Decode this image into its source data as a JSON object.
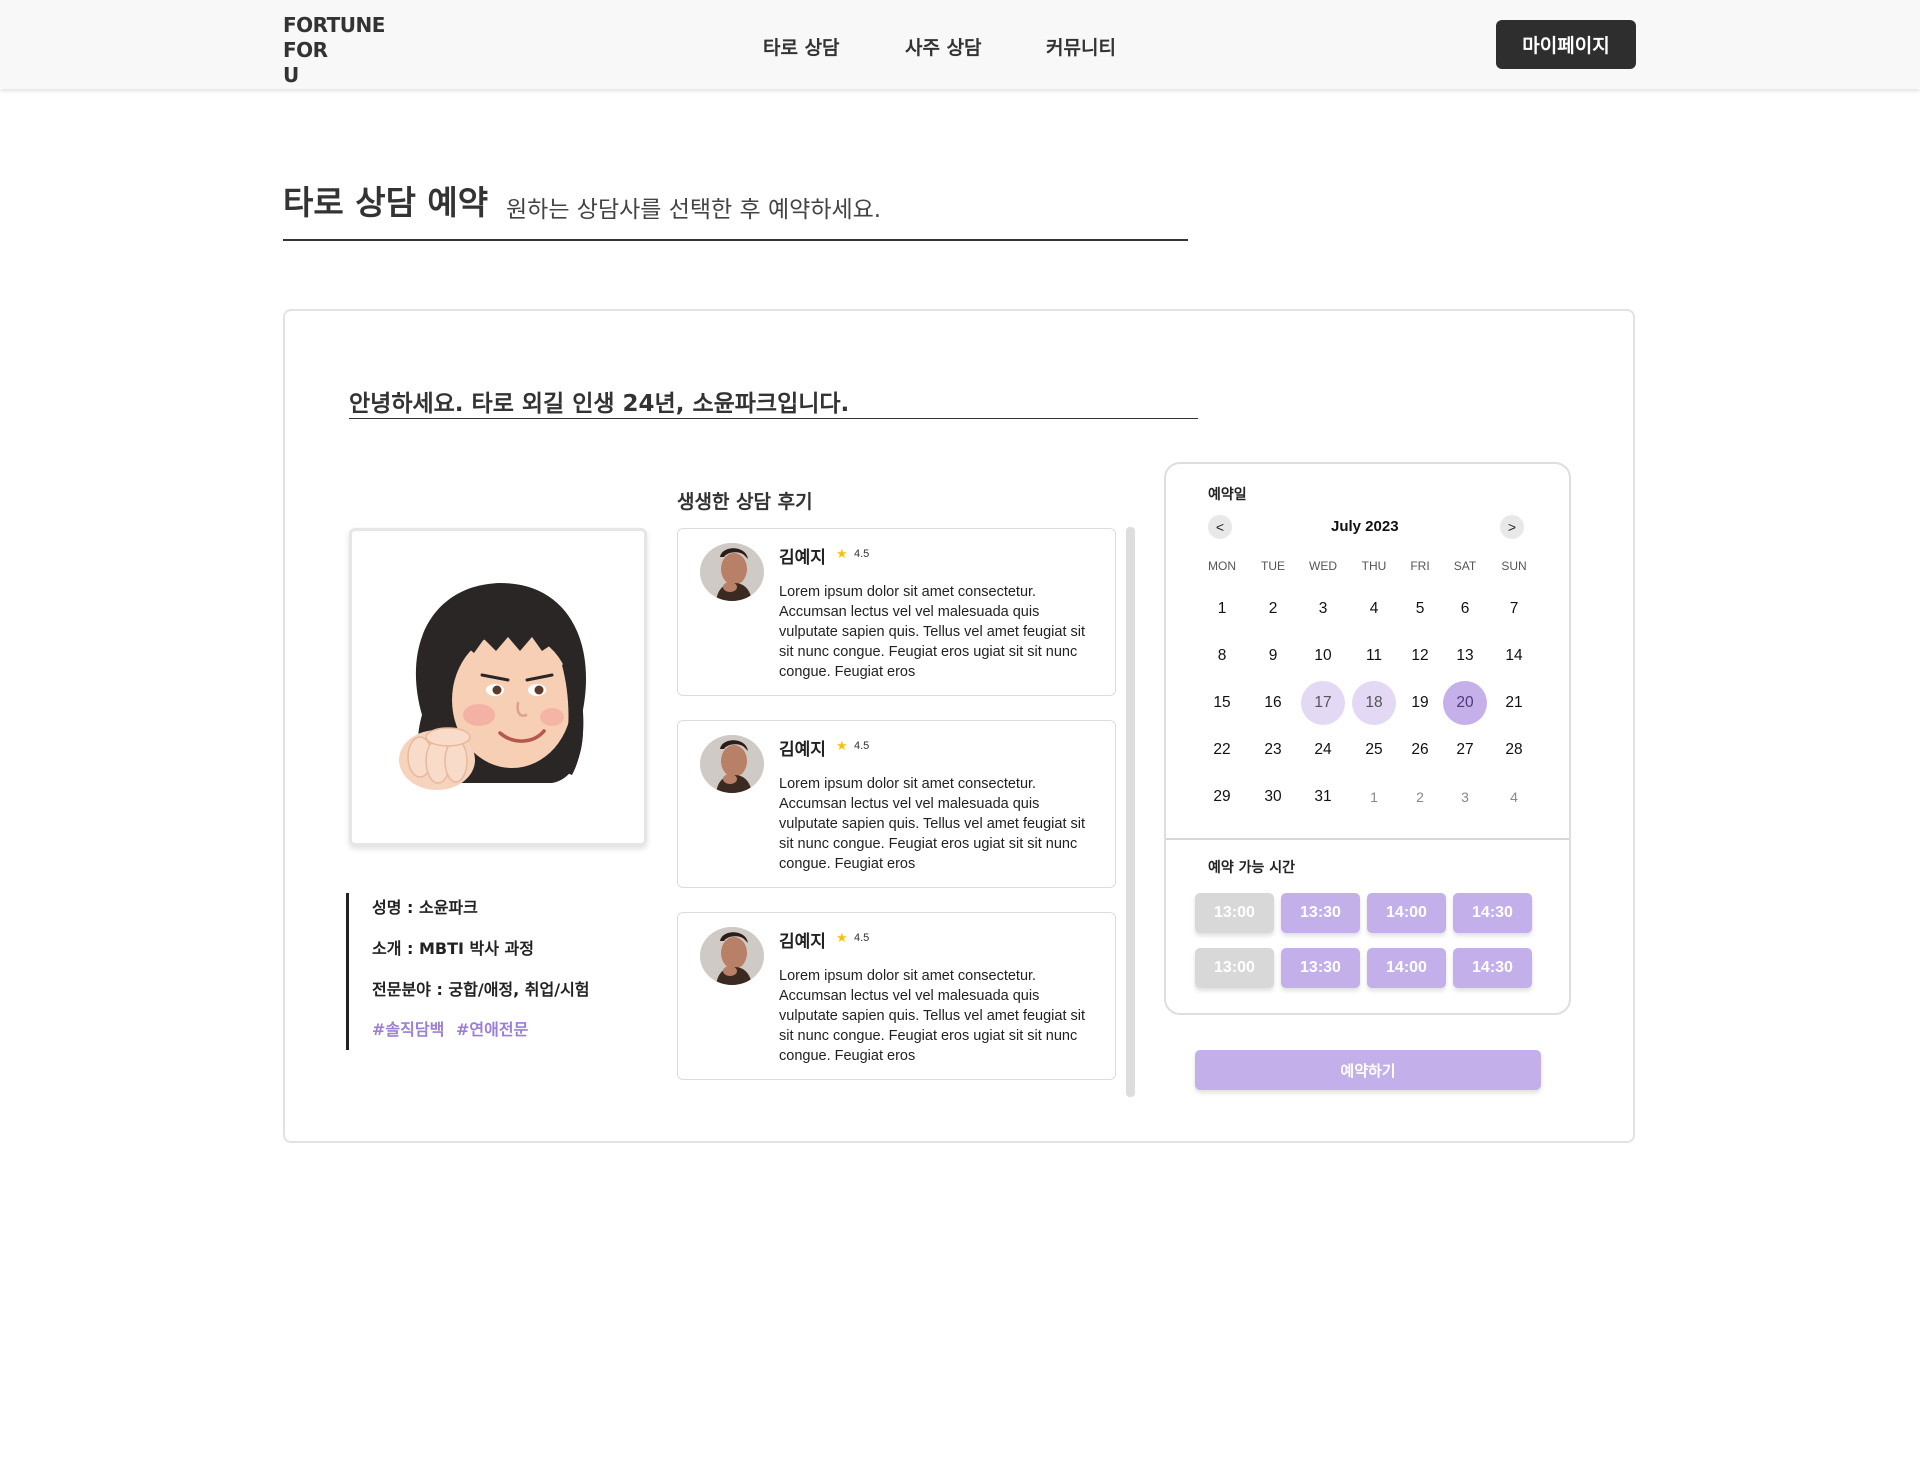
{
  "header": {
    "logo_lines": [
      "FORTUNE",
      "FOR",
      "U"
    ],
    "nav": [
      "타로 상담",
      "사주 상담",
      "커뮤니티"
    ],
    "mypage": "마이페이지"
  },
  "page": {
    "title": "타로 상담 예약",
    "subtitle": "원하는 상담사를 선택한 후 예약하세요."
  },
  "counselor": {
    "greeting": "안녕하세요. 타로 외길 인생 24년, 소윤파크입니다.",
    "name_line": "성명 : 소윤파크",
    "intro_line": "소개 : MBTI 박사 과정",
    "specialty_line": "전문분야 : 궁합/애정, 취업/시험",
    "tags": [
      "#솔직담백",
      "#연애전문"
    ]
  },
  "reviews": {
    "title": "생생한 상담 후기",
    "items": [
      {
        "name": "김예지",
        "rating": "4.5",
        "text": "Lorem ipsum dolor sit amet consectetur. Accumsan lectus vel vel malesuada quis vulputate sapien quis. Tellus vel amet feugiat sit sit nunc congue. Feugiat eros ugiat sit sit nunc congue. Feugiat eros"
      },
      {
        "name": "김예지",
        "rating": "4.5",
        "text": "Lorem ipsum dolor sit amet consectetur. Accumsan lectus vel vel malesuada quis vulputate sapien quis. Tellus vel amet feugiat sit sit nunc congue. Feugiat eros ugiat sit sit nunc congue. Feugiat eros"
      },
      {
        "name": "김예지",
        "rating": "4.5",
        "text": "Lorem ipsum dolor sit amet consectetur. Accumsan lectus vel vel malesuada quis vulputate sapien quis. Tellus vel amet feugiat sit sit nunc congue. Feugiat eros ugiat sit sit nunc congue. Feugiat eros"
      }
    ]
  },
  "calendar": {
    "label": "예약일",
    "month": "July 2023",
    "prev": "<",
    "next": ">",
    "weekdays": [
      "MON",
      "TUE",
      "WED",
      "THU",
      "FRI",
      "SAT",
      "SUN"
    ],
    "weeks": [
      [
        "1",
        "2",
        "3",
        "4",
        "5",
        "6",
        "7"
      ],
      [
        "8",
        "9",
        "10",
        "11",
        "12",
        "13",
        "14"
      ],
      [
        "15",
        "16",
        "17",
        "18",
        "19",
        "20",
        "21"
      ],
      [
        "22",
        "23",
        "24",
        "25",
        "26",
        "27",
        "28"
      ],
      [
        "29",
        "30",
        "31",
        "1",
        "2",
        "3",
        "4"
      ]
    ],
    "highlighted_light": [
      "17",
      "18"
    ],
    "selected": "20",
    "next_month_days": [
      "1",
      "2",
      "3",
      "4"
    ]
  },
  "times": {
    "label": "예약 가능 시간",
    "rows": [
      [
        {
          "t": "13:00",
          "available": false
        },
        {
          "t": "13:30",
          "available": true
        },
        {
          "t": "14:00",
          "available": true
        },
        {
          "t": "14:30",
          "available": true
        }
      ],
      [
        {
          "t": "13:00",
          "available": false
        },
        {
          "t": "13:30",
          "available": true
        },
        {
          "t": "14:00",
          "available": true
        },
        {
          "t": "14:30",
          "available": true
        }
      ]
    ]
  },
  "reserve": "예약하기",
  "colors": {
    "accent": "#c3b0ea",
    "accent_dark": "#9b7fd4",
    "header_bg": "#f8f8f8",
    "button_dark": "#2e2e2e",
    "slot_disabled": "#d8d8d8"
  }
}
